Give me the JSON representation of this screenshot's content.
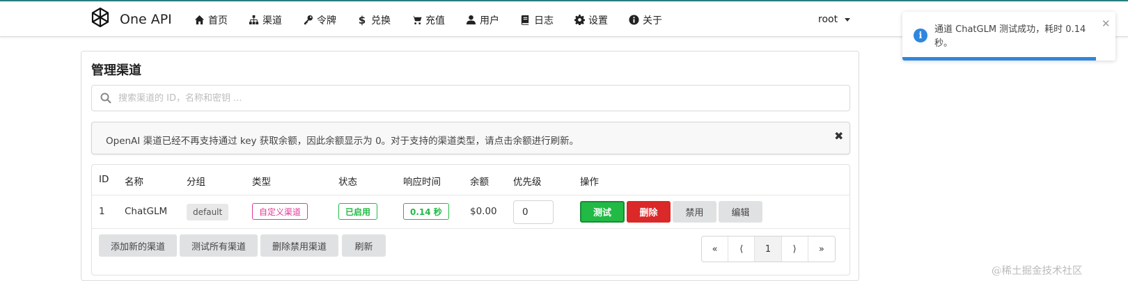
{
  "header": {
    "brand": "One API",
    "nav": [
      {
        "label": "首页",
        "icon": "home-icon"
      },
      {
        "label": "渠道",
        "icon": "sitemap-icon"
      },
      {
        "label": "令牌",
        "icon": "key-icon"
      },
      {
        "label": "兑换",
        "icon": "dollar-icon"
      },
      {
        "label": "充值",
        "icon": "cart-icon"
      },
      {
        "label": "用户",
        "icon": "user-icon"
      },
      {
        "label": "日志",
        "icon": "book-icon"
      },
      {
        "label": "设置",
        "icon": "gear-icon"
      },
      {
        "label": "关于",
        "icon": "info-icon"
      }
    ],
    "user": "root"
  },
  "toast": {
    "message": "通道 ChatGLM 测试成功，耗时 0.14 秒。",
    "progress": 0.91,
    "accent": "#2f87d8"
  },
  "page": {
    "title": "管理渠道",
    "search_placeholder": "搜索渠道的 ID，名称和密钥 ...",
    "notice": "OpenAI 渠道已经不再支持通过 key 获取余额，因此余额显示为 0。对于支持的渠道类型，请点击余额进行刷新。"
  },
  "table": {
    "headers": [
      "ID",
      "名称",
      "分组",
      "类型",
      "状态",
      "响应时间",
      "余额",
      "优先级",
      "操作"
    ],
    "rows": [
      {
        "id": "1",
        "name": "ChatGLM",
        "group": "default",
        "type": "自定义渠道",
        "status": "已启用",
        "response_time": "0.14 秒",
        "balance": "$0.00",
        "priority": "0",
        "actions": [
          "测试",
          "删除",
          "禁用",
          "编辑"
        ]
      }
    ]
  },
  "footer": {
    "buttons": [
      "添加新的渠道",
      "测试所有渠道",
      "删除禁用渠道",
      "刷新"
    ],
    "pagination": [
      "«",
      "⟨",
      "1",
      "⟩",
      "»"
    ],
    "current_page": "1"
  },
  "watermark": "@稀土掘金技术社区",
  "colors": {
    "green": "#21ba45",
    "red": "#db2828",
    "pink": "#e03997",
    "blue": "#2e86de"
  }
}
